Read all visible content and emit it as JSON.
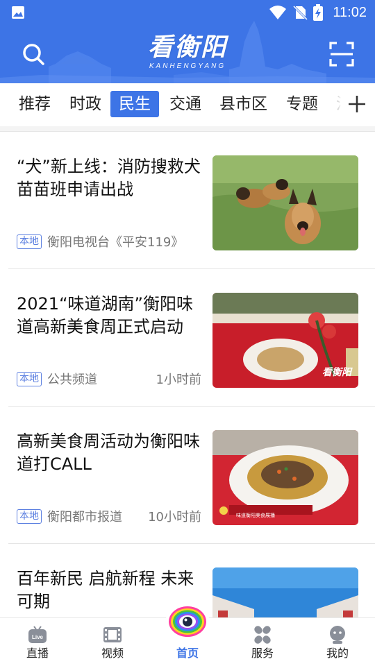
{
  "status": {
    "time": "11:02"
  },
  "header": {
    "logo_title": "看衡阳",
    "logo_subtitle": "KANHENGYANG"
  },
  "tabs": [
    {
      "label": "推荐"
    },
    {
      "label": "时政"
    },
    {
      "label": "民生",
      "active": true
    },
    {
      "label": "交通"
    },
    {
      "label": "县市区"
    },
    {
      "label": "专题"
    },
    {
      "label": "汽"
    }
  ],
  "news": [
    {
      "title": "“犬”新上线：消防搜救犬苗苗班申请出战",
      "badge": "本地",
      "source": "衡阳电视台《平安119》",
      "time": ""
    },
    {
      "title": "2021“味道湖南”衡阳味道高新美食周正式启动",
      "badge": "本地",
      "source": "公共频道",
      "time": "1小时前"
    },
    {
      "title": "高新美食周活动为衡阳味道打CALL",
      "badge": "本地",
      "source": "衡阳都市报道",
      "time": "10小时前"
    },
    {
      "title": "百年新民 启航新程 未来可期",
      "badge": "",
      "source": "",
      "time": ""
    }
  ],
  "thumb_text": {
    "item2_watermark": "看衡阳",
    "item3_caption": "味道衡阳美食展播"
  },
  "bottom_nav": [
    {
      "label": "直播",
      "icon": "live-tv-icon",
      "active": false,
      "icon_text": "Live"
    },
    {
      "label": "视频",
      "icon": "film-icon",
      "active": false
    },
    {
      "label": "首页",
      "icon": "eye-icon",
      "active": true
    },
    {
      "label": "服务",
      "icon": "grid-icon",
      "active": false
    },
    {
      "label": "我的",
      "icon": "user-icon",
      "active": false
    }
  ],
  "colors": {
    "brand": "#3d74e6",
    "badge": "#5b7fe0",
    "meta": "#777777",
    "nav_inactive": "#8a8f99"
  }
}
